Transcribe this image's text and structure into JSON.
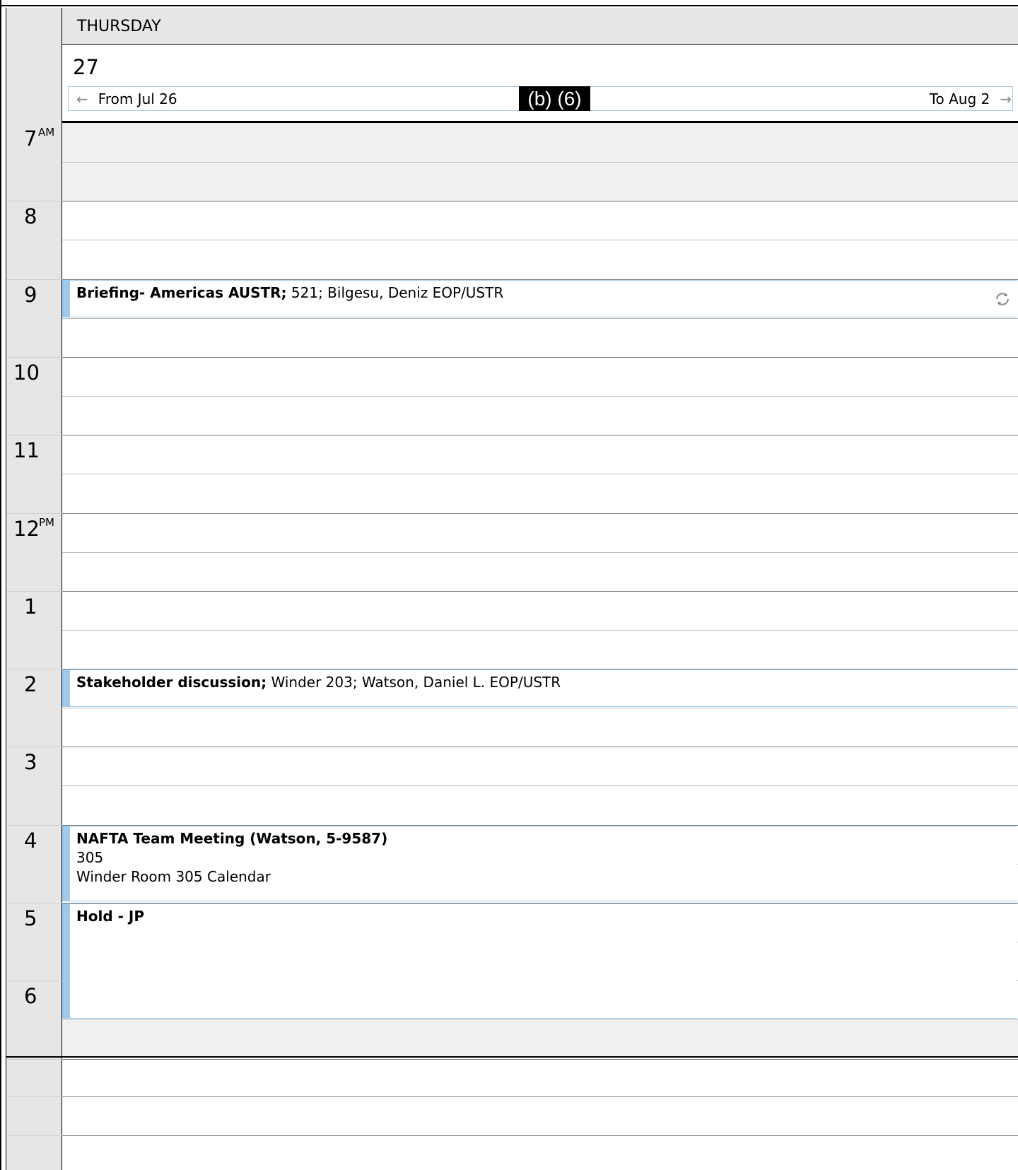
{
  "header": {
    "day_name": "THURSDAY",
    "day_number": "27",
    "nav_prev_label": "From Jul 26",
    "nav_next_label": "To Aug 2",
    "redaction_label": "(b) (6)"
  },
  "hours": [
    {
      "label": "7",
      "suffix": "AM"
    },
    {
      "label": "8",
      "suffix": ""
    },
    {
      "label": "9",
      "suffix": ""
    },
    {
      "label": "10",
      "suffix": ""
    },
    {
      "label": "11",
      "suffix": ""
    },
    {
      "label": "12",
      "suffix": "PM"
    },
    {
      "label": "1",
      "suffix": ""
    },
    {
      "label": "2",
      "suffix": ""
    },
    {
      "label": "3",
      "suffix": ""
    },
    {
      "label": "4",
      "suffix": ""
    },
    {
      "label": "5",
      "suffix": ""
    },
    {
      "label": "6",
      "suffix": ""
    }
  ],
  "events": [
    {
      "title": "Briefing- Americas AUSTR;",
      "detail": " 521; Bilgesu, Deniz EOP/USTR",
      "recurring": true
    },
    {
      "title": "Stakeholder discussion;",
      "detail": " Winder 203; Watson, Daniel L. EOP/USTR",
      "recurring": false
    },
    {
      "title": "NAFTA Team Meeting (Watson, 5-9587)",
      "line2": "305",
      "line3": "Winder Room 305 Calendar",
      "recurring": false
    },
    {
      "title": "Hold - JP",
      "recurring": false
    }
  ],
  "colors": {
    "event_accent": "#9fc9ea",
    "header_bg": "#e6e6e6",
    "gutter_bg": "#e6e6e6",
    "offhours_bg": "#f0f0f0"
  },
  "icons": {
    "prev": "arrow-left-icon",
    "next": "arrow-right-icon",
    "recurring": "recurring-icon"
  }
}
